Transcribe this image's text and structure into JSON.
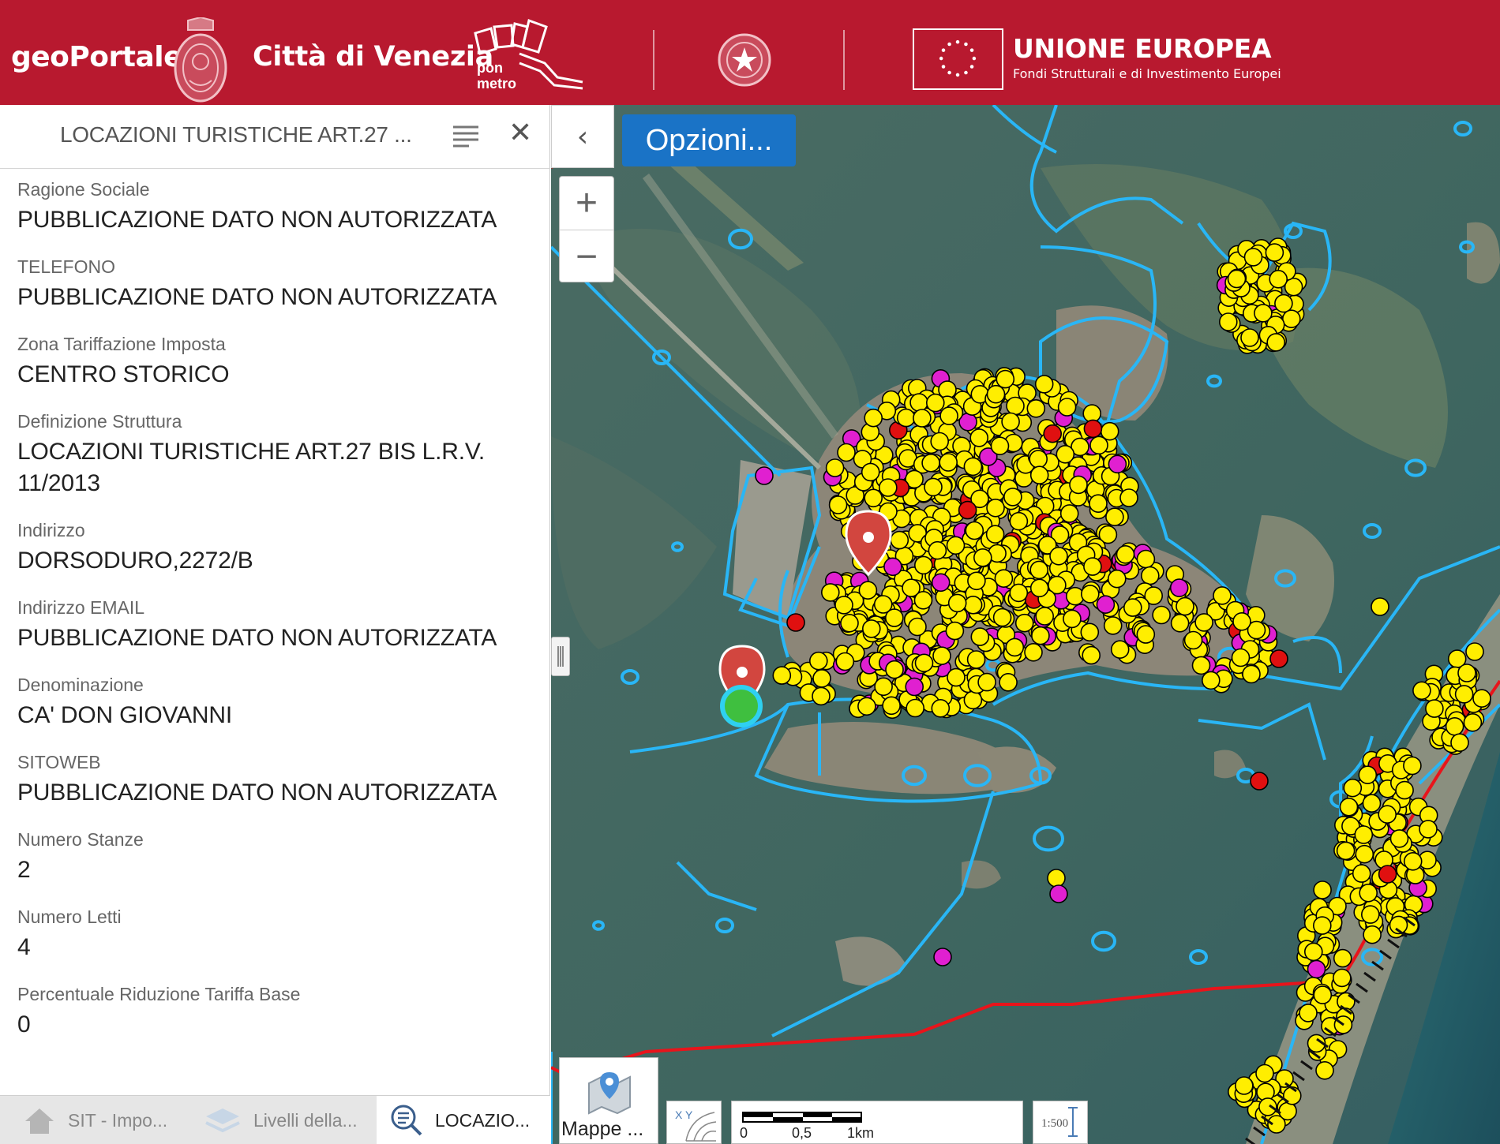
{
  "header": {
    "brand": "geoPortale",
    "city": "Città di Venezia",
    "ponmetro_label_1": "pon",
    "ponmetro_label_2": "metro",
    "eu_title": "UNIONE EUROPEA",
    "eu_subtitle": "Fondi Strutturali e di Investimento Europei",
    "color": "#b8192f"
  },
  "panel": {
    "title": "LOCAZIONI TURISTICHE ART.27 ...",
    "fields": [
      {
        "label": "Ragione Sociale",
        "value": "PUBBLICAZIONE DATO NON AUTORIZZATA"
      },
      {
        "label": "TELEFONO",
        "value": "PUBBLICAZIONE DATO NON AUTORIZZATA"
      },
      {
        "label": "Zona Tariffazione Imposta",
        "value": "CENTRO STORICO"
      },
      {
        "label": "Definizione Struttura",
        "value": "LOCAZIONI TURISTICHE ART.27 BIS L.R.V. 11/2013"
      },
      {
        "label": "Indirizzo",
        "value": "DORSODURO,2272/B"
      },
      {
        "label": "Indirizzo EMAIL",
        "value": "PUBBLICAZIONE DATO NON AUTORIZZATA"
      },
      {
        "label": "Denominazione",
        "value": "CA' DON GIOVANNI"
      },
      {
        "label": "SITOWEB",
        "value": "PUBBLICAZIONE DATO NON AUTORIZZATA"
      },
      {
        "label": "Numero Stanze",
        "value": "2"
      },
      {
        "label": "Numero Letti",
        "value": "4"
      },
      {
        "label": "Percentuale Riduzione Tariffa Base",
        "value": "0"
      }
    ],
    "tabs": [
      {
        "label": "SIT - Impo...",
        "icon": "home-icon"
      },
      {
        "label": "Livelli della...",
        "icon": "layers-icon"
      },
      {
        "label": "LOCAZIO...",
        "icon": "search-list-icon"
      }
    ]
  },
  "map": {
    "options_label": "Opzioni...",
    "zoom_in": "+",
    "zoom_out": "−",
    "basemaps_label": "Mappe ...",
    "scale_labels": [
      "0",
      "0,5",
      "1km"
    ],
    "scale_btn_label": "1:500",
    "coord_label": "X Y",
    "colors": {
      "water": "#42655e",
      "boundary": "#29b6f6",
      "municipal_line": "#e8141b",
      "poi_main": "#ffee00",
      "poi_alt": "#e020d0",
      "poi_red": "#e01010"
    }
  }
}
